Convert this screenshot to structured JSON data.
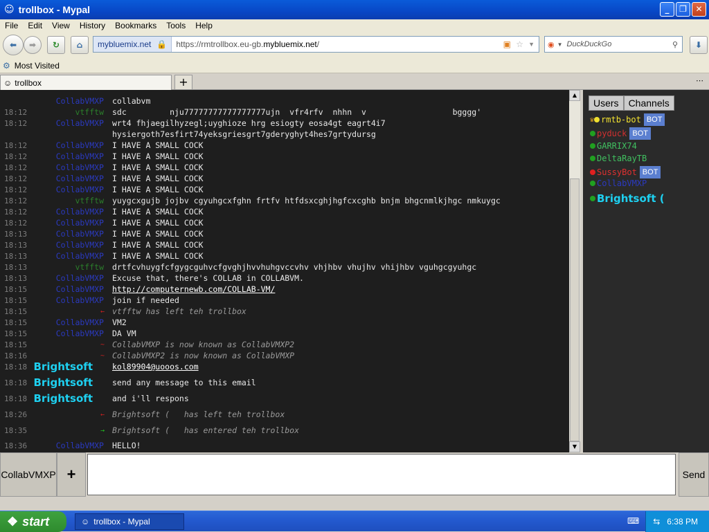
{
  "window": {
    "title": "trollbox - Mypal"
  },
  "menu": [
    "File",
    "Edit",
    "View",
    "History",
    "Bookmarks",
    "Tools",
    "Help"
  ],
  "nav": {
    "site": "mybluemix.net",
    "url_prefix": "https://rmtrollbox.eu-gb.",
    "url_domain": "mybluemix.net",
    "url_suffix": "/",
    "search_placeholder": "DuckDuckGo"
  },
  "bookmarks": {
    "item": "Most Visited"
  },
  "tabs": {
    "active": "trollbox"
  },
  "chat": [
    {
      "time": "",
      "nick": "CollabVMXP",
      "nc": "lb",
      "msg": "collabvm"
    },
    {
      "time": "18:12",
      "nick": "vtfftw",
      "nc": "gr",
      "msg": "sdc         nju77777777777777777ujn  vfr4rfv  nhhn  v                  bgggg'"
    },
    {
      "time": "18:12",
      "nick": "CollabVMXP",
      "nc": "lb",
      "msg": "wrt4 fhjaegilhyzegl;uyghioze hrg esiogty eosa4gt eagrt4i7"
    },
    {
      "time": "",
      "nick": "",
      "nc": "lb",
      "msg": "hysiergoth7esfirt74yeksgriesgrt7gderyghyt4hes7grtydursg"
    },
    {
      "time": "18:12",
      "nick": "CollabVMXP",
      "nc": "lb",
      "msg": "I HAVE A SMALL COCK"
    },
    {
      "time": "18:12",
      "nick": "CollabVMXP",
      "nc": "lb",
      "msg": "I HAVE A SMALL COCK"
    },
    {
      "time": "18:12",
      "nick": "CollabVMXP",
      "nc": "lb",
      "msg": "I HAVE A SMALL COCK"
    },
    {
      "time": "18:12",
      "nick": "CollabVMXP",
      "nc": "lb",
      "msg": "I HAVE A SMALL COCK"
    },
    {
      "time": "18:12",
      "nick": "CollabVMXP",
      "nc": "lb",
      "msg": "I HAVE A SMALL COCK"
    },
    {
      "time": "18:12",
      "nick": "vtfftw",
      "nc": "gr",
      "msg": "yuygcxgujb jojbv cgyuhgcxfghn frtfv htfdsxcghjhgfcxcghb bnjm bhgcnmlkjhgc nmkuygc"
    },
    {
      "time": "18:12",
      "nick": "CollabVMXP",
      "nc": "lb",
      "msg": "I HAVE A SMALL COCK"
    },
    {
      "time": "18:12",
      "nick": "CollabVMXP",
      "nc": "lb",
      "msg": "I HAVE A SMALL COCK"
    },
    {
      "time": "18:13",
      "nick": "CollabVMXP",
      "nc": "lb",
      "msg": "I HAVE A SMALL COCK"
    },
    {
      "time": "18:13",
      "nick": "CollabVMXP",
      "nc": "lb",
      "msg": "I HAVE A SMALL COCK"
    },
    {
      "time": "18:13",
      "nick": "CollabVMXP",
      "nc": "lb",
      "msg": "I HAVE A SMALL COCK"
    },
    {
      "time": "18:13",
      "nick": "vtfftw",
      "nc": "gr",
      "msg": "drtfcvhuygfcfgygcguhvcfgvghjhvvhuhgvccvhv vhjhbv vhujhv vhijhbv vguhgcgyuhgc"
    },
    {
      "time": "18:13",
      "nick": "CollabVMXP",
      "nc": "lb",
      "msg": "Excuse that, there's COLLAB in COLLABVM."
    },
    {
      "time": "18:15",
      "nick": "CollabVMXP",
      "nc": "lb",
      "msg": "http://computernewb.com/COLLAB-VM/",
      "link": true
    },
    {
      "time": "18:15",
      "nick": "CollabVMXP",
      "nc": "lb",
      "msg": "join if needed"
    },
    {
      "time": "18:15",
      "nick": "",
      "nc": "lb",
      "msg": "vtfftw has left teh trollbox",
      "sys": true,
      "arrow": "←",
      "ac": "#d02020"
    },
    {
      "time": "18:15",
      "nick": "CollabVMXP",
      "nc": "lb",
      "msg": "VM2"
    },
    {
      "time": "18:15",
      "nick": "CollabVMXP",
      "nc": "lb",
      "msg": "DA VM"
    },
    {
      "time": "18:15",
      "nick": "",
      "nc": "lb",
      "msg": "CollabVMXP is now known as CollabVMXP2",
      "sys": true,
      "arrow": "~",
      "ac": "#d02020"
    },
    {
      "time": "18:16",
      "nick": "",
      "nc": "lb",
      "msg": "CollabVMXP2 is now known as CollabVMXP",
      "sys": true,
      "arrow": "~",
      "ac": "#d02020"
    },
    {
      "time": "18:18",
      "nick": "Brightsoft",
      "nc": "bs",
      "msg": "kol89904@uooos.com",
      "link": true
    },
    {
      "time": "18:18",
      "nick": "Brightsoft",
      "nc": "bs",
      "msg": "send any message to this email"
    },
    {
      "time": "18:18",
      "nick": "Brightsoft",
      "nc": "bs",
      "msg": "and i'll respons"
    },
    {
      "time": "18:26",
      "nick": "",
      "nc": "bs",
      "msg": "Brightsoft (   has left teh trollbox",
      "sys": true,
      "arrow": "←",
      "ac": "#d02020"
    },
    {
      "time": "18:35",
      "nick": "",
      "nc": "bs",
      "msg": "Brightsoft (   has entered teh trollbox",
      "sys": true,
      "arrow": "→",
      "ac": "#20c020"
    },
    {
      "time": "18:36",
      "nick": "CollabVMXP",
      "nc": "lb",
      "msg": "HELLO!"
    }
  ],
  "sidebar": {
    "tabs": [
      "Users",
      "Channels"
    ],
    "users": [
      {
        "name": "rmtb-bot",
        "color": "#f0e030",
        "dot": "#f0e030",
        "bot": true
      },
      {
        "name": "pyduck",
        "color": "#d03030",
        "dot": "#20a020",
        "bot": true
      },
      {
        "name": "GARRIX74",
        "color": "#40c060",
        "dot": "#20a020",
        "bot": false
      },
      {
        "name": "DeltaRayTB",
        "color": "#40c060",
        "dot": "#20a020",
        "bot": false
      },
      {
        "name": "SussyBot",
        "color": "#e03030",
        "dot": "#e02020",
        "bot": true
      },
      {
        "name": "CollabVMXP",
        "color": "#2b3ac0",
        "dot": "#20a020",
        "bot": false
      },
      {
        "name": "Brightsoft (",
        "color": "#1ed0f0",
        "dot": "#20a020",
        "bot": false,
        "big": true
      }
    ],
    "bot_label": "BOT"
  },
  "compose": {
    "channel": "CollabVMXP",
    "add": "+",
    "send": "Send"
  },
  "taskbar": {
    "start": "start",
    "task": "trollbox - Mypal",
    "clock": "6:38 PM"
  }
}
